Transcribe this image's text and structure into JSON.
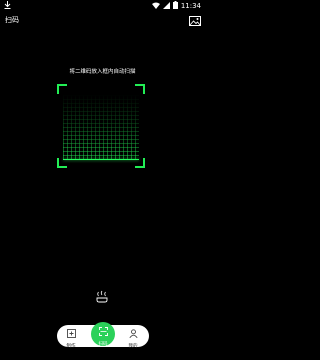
{
  "status_bar": {
    "left_icon": "download-icon",
    "time": "11:34",
    "right_icons": [
      "wifi-icon",
      "signal-icon",
      "battery-icon"
    ]
  },
  "app_bar": {
    "title": "扫码",
    "album_icon": "image-icon"
  },
  "scanner": {
    "hint": "将二维码放入框内自动扫描",
    "accent_color": "#22ee55"
  },
  "flashlight": {
    "icon": "flashlight-icon"
  },
  "bottom_nav": {
    "items": [
      {
        "label": "制作",
        "icon": "create-icon",
        "active": false
      },
      {
        "label": "扫码",
        "icon": "scan-icon",
        "active": true
      },
      {
        "label": "我的",
        "icon": "profile-icon",
        "active": false
      }
    ],
    "active_color": "#2bd15a"
  }
}
